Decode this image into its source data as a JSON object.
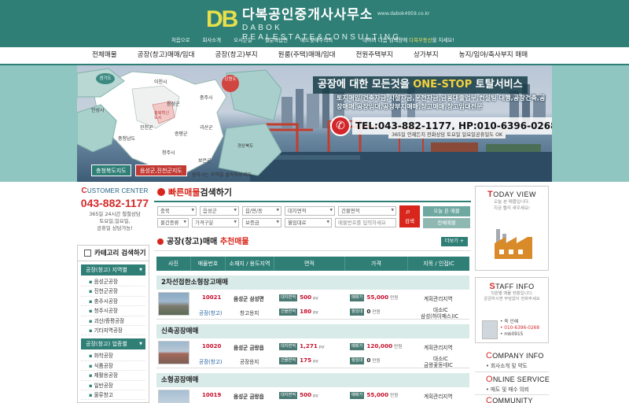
{
  "header": {
    "logo_mark": "DB",
    "title": "다복공인중개사사무소",
    "url": "www.dabok4959.co.kr",
    "subtitle": "DABOK REALESTATE&CONSULTING",
    "topnav": [
      "처음으로",
      "회사소개",
      "오시는길",
      "질문과답변",
      "매도및매수의뢰"
    ],
    "notice_prefix": "네이버 다음 검색창에",
    "notice_keyword": "다복부동산",
    "notice_suffix": "을 치세요!"
  },
  "mainnav": [
    "전체매물",
    "공장(창고)매매/임대",
    "공장(창고)부지",
    "원룸(주택)매매/임대",
    "전원주택부지",
    "상가부지",
    "농지/임야/축사부지 매매"
  ],
  "banner": {
    "regions": {
      "gyeonggi": "경기도",
      "icheon": "이천시",
      "anseong": "안성시",
      "eumseong": "음성군",
      "chungju": "충주시",
      "jincheon": "진천군",
      "jeungpyeong": "증평군",
      "cheongju": "청주시",
      "goesan": "괴산군",
      "chungnam": "충청남도",
      "boeun": "보은군",
      "hyeoksin": "충북혁신도시",
      "gangwon": "강원도",
      "gyeongbuk": "경상북도"
    },
    "btn_chungbuk": "충청북도지도",
    "btn_eumseong": "음성군,진천군지도",
    "map_note": "원하시는 지역을 클릭해보세요.",
    "headline_pre": "공장에 대한 모든것을",
    "headline_key": "ONE-STOP",
    "headline_post": "토탈서비스",
    "desc": "토지매입/건축자금,시설자금,운전자금,금융대출업무,컨설팅 대행,공장건축,공장매매,공장임대,공장부지매매,창고매매,창고임대전문",
    "phone": "TEL:043-882-1177, HP:010-6396-0268",
    "phone_sub": "365일 언제든지 전화상담 토요일 일요일공휴일도 OK"
  },
  "customer_center": {
    "title_pre": "C",
    "title_rest": "USTOMER CENTER",
    "phone": "043-882-1177",
    "info": [
      "365일 24시간 철철상담",
      "토요일,일요일,",
      "공휴일 상담가능!"
    ]
  },
  "category": {
    "title": "카테고리 검색하기",
    "group1": "공장(창고) 지역별",
    "group1_items": [
      "음성군공장",
      "진천군공장",
      "충주시공장",
      "청주시공장",
      "괴산/증평공장",
      "기타지역공장"
    ],
    "group2": "공장(창고) 업종별",
    "group2_items": [
      "화학공장",
      "식품공장",
      "제활용공장",
      "일반공장",
      "물류창고"
    ]
  },
  "quick_search": {
    "title_key": "빠른매물",
    "title_rest": "검색하기",
    "row1": [
      "충북",
      "음성군",
      "읍/면/동",
      "대지면적",
      "건물면적"
    ],
    "row2": [
      "물건종류",
      "가격구분",
      "보증금",
      "월임대료"
    ],
    "input_placeholder": "매물번호를 입력하세요",
    "search_btn": "검색",
    "today_btn": "오늘 본 매물",
    "all_btn": "전체매물"
  },
  "recommended": {
    "title_pre": "공장(창고)매매",
    "title_key": "추천매물",
    "more": "더보기 +",
    "columns": [
      "사진",
      "매물번호",
      "소재지 / 용도지역",
      "면적",
      "가격",
      "지목 / 인접IC"
    ],
    "groups": [
      {
        "name": "2차선접한소형창고매매",
        "code": "10021",
        "type": "공장(창고)",
        "location": "음성군 삼성면",
        "zoning": "창고용지",
        "land_label": "대지면적",
        "land": "500",
        "land_unit": "py",
        "bldg_label": "건물면적",
        "bldg": "180",
        "bldg_unit": "py",
        "sale_label": "매매가",
        "sale": "55,000",
        "sale_unit": "만원",
        "rent_label": "월임대",
        "rent": "0",
        "rent_unit": "만원",
        "jimok": "계획관리지역",
        "ic": [
          "대소IC",
          "삼성(하이패스)IC"
        ]
      },
      {
        "name": "신축공장매매",
        "code": "10020",
        "type": "공장(창고)",
        "location": "음성군 금왕읍",
        "zoning": "공장용지",
        "land_label": "대지면적",
        "land": "1,271",
        "land_unit": "py",
        "bldg_label": "건물면적",
        "bldg": "175",
        "bldg_unit": "py",
        "sale_label": "매매가",
        "sale": "120,000",
        "sale_unit": "만원",
        "rent_label": "월임대",
        "rent": "0",
        "rent_unit": "만원",
        "jimok": "계획관리지역",
        "ic": [
          "대소IC",
          "금왕꽃동네IC"
        ]
      },
      {
        "name": "소형공장매매",
        "code": "10019",
        "type": "",
        "location": "음성군 금왕읍",
        "zoning": "",
        "land_label": "대지면적",
        "land": "500",
        "land_unit": "py",
        "bldg_label": "",
        "bldg": "",
        "bldg_unit": "",
        "sale_label": "매매가",
        "sale": "55,000",
        "sale_unit": "만원",
        "rent_label": "",
        "rent": "",
        "rent_unit": "",
        "jimok": "계획관리지역",
        "ic": [
          "",
          ""
        ]
      }
    ]
  },
  "today_view": {
    "title_pre": "T",
    "title_rest": "ODAY VIEW",
    "sub1": "오늘 본 매물입니다.",
    "sub2": "지금 빨리 새우세요!"
  },
  "staff": {
    "title_pre": "S",
    "title_rest": "TAFF INFO",
    "sub1": "직원별 매물 현황입니다.",
    "sub2": "궁금하시면 부담없이 전화주세요",
    "name": "• 육 인혜",
    "phone": "• 010-6396-0268",
    "id": "• mb0915"
  },
  "company_info": {
    "title_pre": "C",
    "title_rest": "OMPANY INFO",
    "sub": "• 회사소개 및 약도"
  },
  "online_service": {
    "title_pre": "O",
    "title_rest": "NLINE SERVICE",
    "sub": "• 매도 및 매수 의뢰"
  },
  "community": {
    "title_pre": "C",
    "title_rest": "OMMUNITY"
  },
  "colors": {
    "brand": "#2f7f77",
    "accent": "#d9261c",
    "logo": "#e7e04a"
  }
}
